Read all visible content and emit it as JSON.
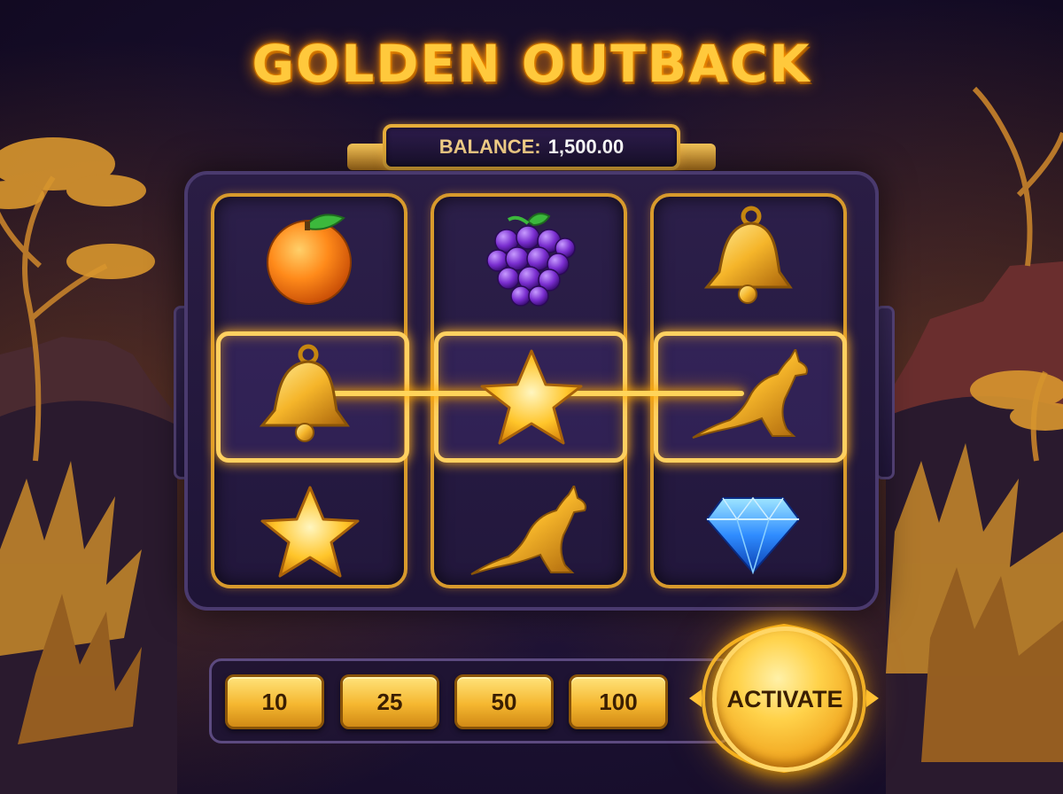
{
  "title": "GOLDEN OUTBACK",
  "balance": {
    "label": "BALANCE:",
    "value": "1,500.00"
  },
  "reels": [
    {
      "symbols": [
        "orange",
        "bell",
        "star"
      ]
    },
    {
      "symbols": [
        "grapes",
        "star",
        "kangaroo"
      ]
    },
    {
      "symbols": [
        "bell",
        "kangaroo",
        "diamond"
      ]
    }
  ],
  "win_line": {
    "row": 2,
    "symbols": [
      "bell",
      "star",
      "kangaroo"
    ]
  },
  "bets": [
    {
      "label": "10"
    },
    {
      "label": "25"
    },
    {
      "label": "50"
    },
    {
      "label": "100"
    }
  ],
  "activate_label": "ACTIVATE",
  "colors": {
    "gold": "#ffc93c",
    "panel": "#2a1d45",
    "highlight": "#ffd060",
    "gem": "#3aa0ff"
  }
}
